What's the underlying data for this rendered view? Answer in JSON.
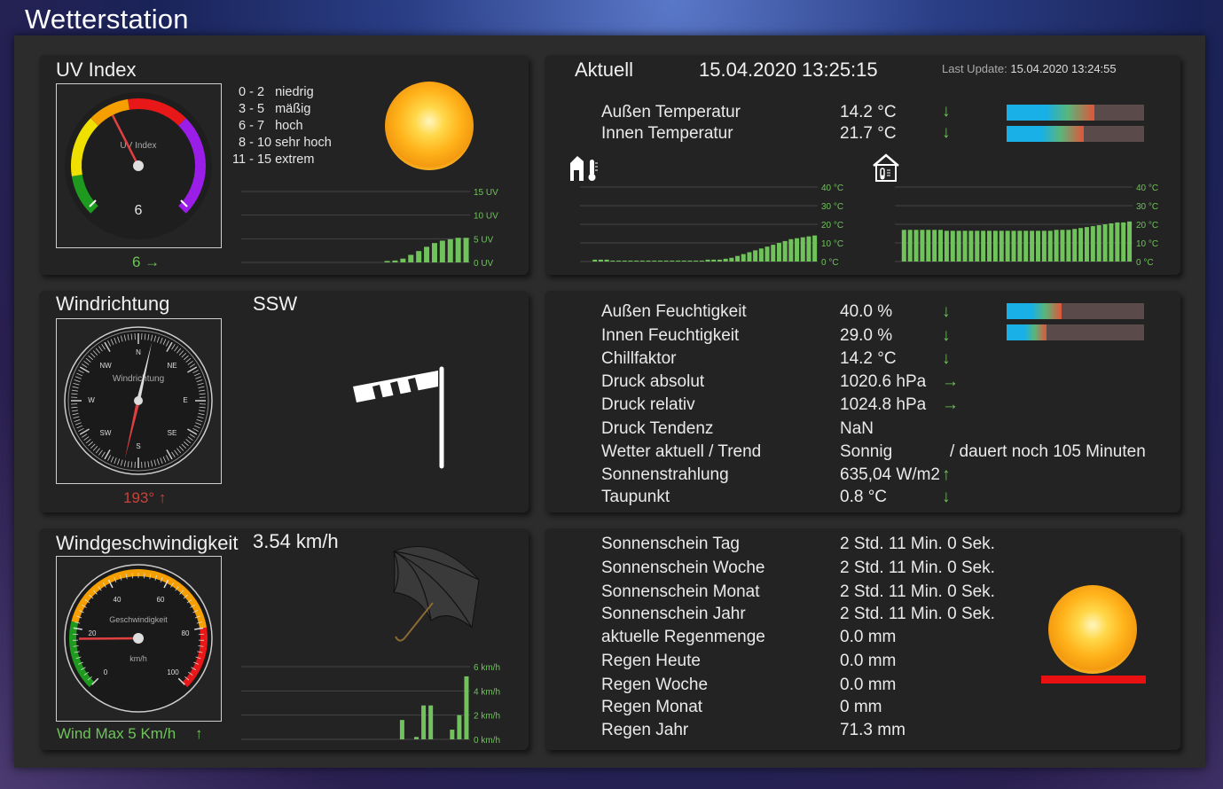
{
  "page": {
    "title": "Wetterstation"
  },
  "uv": {
    "title": "UV Index",
    "dial_label": "UV Index",
    "value": "6",
    "value_num": 6,
    "trend": "6 →",
    "legend": [
      "0 - 2   niedrig",
      "3 - 5   mäßig",
      "6 - 7   hoch",
      "8 - 10 sehr hoch",
      "11 - 15 extrem"
    ],
    "chart_ticks": [
      "15 UV",
      "10 UV",
      "5 UV",
      "0 UV"
    ]
  },
  "aktuell": {
    "title": "Aktuell",
    "date": "15.04.2020",
    "time": "13:25:15",
    "last_update_label": "Last Update:",
    "last_update_value": "15.04.2020 13:24:55",
    "rows": [
      {
        "label": "Außen Temperatur",
        "value": "14.2 °C",
        "trend": "↓",
        "bar": 0.64
      },
      {
        "label": "Innen Temperatur",
        "value": "21.7 °C",
        "trend": "↓",
        "bar": 0.56
      }
    ],
    "chart_ticks": [
      "40 °C",
      "30 °C",
      "20 °C",
      "10 °C",
      "0 °C"
    ]
  },
  "wind_dir": {
    "title": "Windrichtung",
    "direction": "SSW",
    "dial_label": "Windrichtung",
    "degrees": "193° ↑",
    "degrees_num": 193,
    "cardinals": [
      "N",
      "NE",
      "E",
      "SE",
      "S",
      "SW",
      "W",
      "NW"
    ]
  },
  "details": {
    "rows": [
      {
        "label": "Außen Feuchtigkeit",
        "value": "40.0 %",
        "trend": "↓",
        "bar": 0.4
      },
      {
        "label": "Innen Feuchtigkeit",
        "value": "29.0 %",
        "trend": "↓",
        "bar": 0.29
      },
      {
        "label": "Chillfaktor",
        "value": "14.2 °C",
        "trend": "↓"
      },
      {
        "label": "Druck absolut",
        "value": "1020.6 hPa",
        "trend": "→"
      },
      {
        "label": "Druck relativ",
        "value": "1024.8 hPa",
        "trend": "→"
      },
      {
        "label": "Druck Tendenz",
        "value": "NaN",
        "trend": ""
      },
      {
        "label": "Wetter aktuell / Trend",
        "value": "Sonnig",
        "extra": "/  dauert noch 105 Minuten",
        "trend": ""
      },
      {
        "label": "Sonnenstrahlung",
        "value": "635,04 W/m2",
        "trend": "↑"
      },
      {
        "label": "Taupunkt",
        "value": "0.8 °C",
        "trend": "↓"
      }
    ]
  },
  "wind_speed": {
    "title": "Windgeschwindigkeit",
    "value": "3.54 km/h",
    "value_num": 3.54,
    "dial_label": "Geschwindigkeit",
    "dial_unit": "km/h",
    "scale": [
      "0",
      "20",
      "40",
      "60",
      "80",
      "100"
    ],
    "max": "Wind Max 5 Km/h",
    "max_trend": "↑",
    "chart_ticks": [
      "6 km/h",
      "4 km/h",
      "2 km/h",
      "0 km/h"
    ]
  },
  "sun_rain": {
    "rows": [
      {
        "label": "Sonnenschein Tag",
        "value": "2 Std. 11 Min. 0 Sek."
      },
      {
        "label": "Sonnenschein Woche",
        "value": "2 Std. 11 Min. 0 Sek."
      },
      {
        "label": "Sonnenschein Monat",
        "value": "2 Std. 11 Min. 0 Sek."
      },
      {
        "label": "Sonnenschein Jahr",
        "value": "2 Std. 11 Min. 0 Sek."
      },
      {
        "label": "aktuelle Regenmenge",
        "value": "0.0 mm"
      },
      {
        "label": "Regen Heute",
        "value": "0.0 mm"
      },
      {
        "label": "Regen Woche",
        "value": "0.0 mm"
      },
      {
        "label": "Regen Monat",
        "value": "0 mm"
      },
      {
        "label": "Regen Jahr",
        "value": "71.3 mm"
      }
    ]
  },
  "chart_data": [
    {
      "type": "bar",
      "series": [
        {
          "values": [
            0,
            0,
            0,
            0,
            0,
            0,
            0,
            0,
            0,
            0,
            0,
            0,
            0,
            0,
            0,
            0,
            0,
            0,
            0.3,
            0.4,
            0.8,
            1.6,
            2.4,
            3.3,
            4.1,
            4.6,
            4.9,
            5.2,
            5.2
          ]
        }
      ],
      "ylim": [
        0,
        15
      ],
      "yticks": [
        "15 UV",
        "10 UV",
        "5 UV",
        "0 UV"
      ]
    },
    {
      "type": "bar",
      "series": [
        {
          "values": [
            0,
            0,
            1,
            1,
            1,
            0.5,
            0.5,
            0.5,
            0.5,
            0.5,
            0.5,
            0.5,
            0.5,
            0.5,
            0.5,
            0.5,
            0.5,
            0.5,
            0.5,
            0.5,
            0.5,
            1,
            1,
            1,
            1.5,
            2,
            3,
            4,
            5,
            6,
            7,
            8,
            9,
            10,
            11,
            12,
            12.5,
            13,
            13.5,
            14
          ]
        }
      ],
      "ylim": [
        0,
        40
      ],
      "yticks": [
        "40 °C",
        "30 °C",
        "20 °C",
        "10 °C",
        "0 °C"
      ]
    },
    {
      "type": "bar",
      "series": [
        {
          "values": [
            0,
            17,
            17,
            17,
            17,
            17,
            17,
            17,
            16.5,
            16.5,
            16.5,
            16.5,
            16.5,
            16.5,
            16.5,
            16.5,
            16.5,
            16.5,
            16.5,
            16.5,
            16.5,
            16.5,
            16.5,
            16.5,
            16.5,
            16.5,
            17,
            17,
            17,
            17.5,
            18,
            18.5,
            19,
            19.5,
            20,
            20.5,
            21,
            21,
            21.5
          ]
        }
      ],
      "ylim": [
        0,
        40
      ],
      "yticks": [
        "40 °C",
        "30 °C",
        "20 °C",
        "10 °C",
        "0 °C"
      ]
    },
    {
      "type": "bar",
      "series": [
        {
          "values": [
            0,
            0,
            0,
            0,
            0,
            0,
            0,
            0,
            0,
            0,
            0,
            0,
            0,
            0,
            0,
            0,
            0,
            0,
            0,
            0,
            0,
            0,
            1.6,
            0,
            0.2,
            2.8,
            2.8,
            0,
            0,
            0.8,
            2,
            5.2
          ]
        }
      ],
      "ylim": [
        0,
        6
      ],
      "yticks": [
        "6 km/h",
        "4 km/h",
        "2 km/h",
        "0 km/h"
      ]
    }
  ]
}
